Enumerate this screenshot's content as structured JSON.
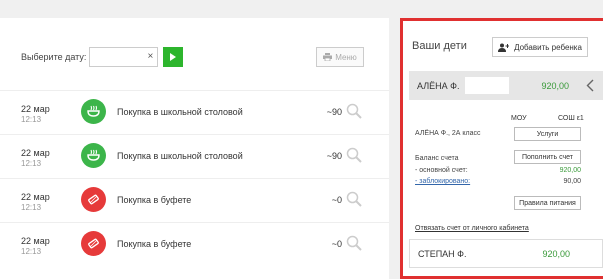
{
  "filter": {
    "date_label": "Выберите дату:",
    "date_value": "",
    "clear": "×",
    "menu_label": "Меню"
  },
  "transactions": [
    {
      "date": "22 мар",
      "time": "12:13",
      "description": "Покупка в школьной столовой",
      "amount": "~90",
      "icon": "canteen-bowl-icon",
      "color": "#3cb54a"
    },
    {
      "date": "22 мар",
      "time": "12:13",
      "description": "Покупка в школьной столовой",
      "amount": "~90",
      "icon": "canteen-bowl-icon",
      "color": "#3cb54a"
    },
    {
      "date": "22 мар",
      "time": "12:13",
      "description": "Покупка в буфете",
      "amount": "~0",
      "icon": "buffet-snack-icon",
      "color": "#e63a3a"
    },
    {
      "date": "22 мар",
      "time": "12:13",
      "description": "Покупка в буфете",
      "amount": "~0",
      "icon": "buffet-snack-icon",
      "color": "#e63a3a"
    }
  ],
  "children_panel": {
    "title": "Ваши дети",
    "add_child_label": "Добавить ребенка",
    "selected_child": {
      "name": "АЛЁНА Ф.",
      "balance": "920,00",
      "org_type": "МОУ",
      "org_name": "СОШ ε1",
      "student": "АЛЁНА Ф., 2А класс",
      "services_label": "Услуги",
      "balance_label": "Баланс счета",
      "topup_label": "Пополнить счет",
      "main_account_label": "- основной счет:",
      "main_account_value": "920,00",
      "blocked_label": "- заблокировано:",
      "blocked_value": "90,00",
      "rules_label": "Правила питания",
      "unlink_label": "Отвязать счет от личного кабинета"
    },
    "other_child": {
      "name": "СТЕПАН Ф.",
      "balance": "920,00"
    }
  },
  "colors": {
    "accent_green": "#2db52d",
    "highlight_border": "#e03030",
    "amount_green": "#3a9a3a"
  }
}
